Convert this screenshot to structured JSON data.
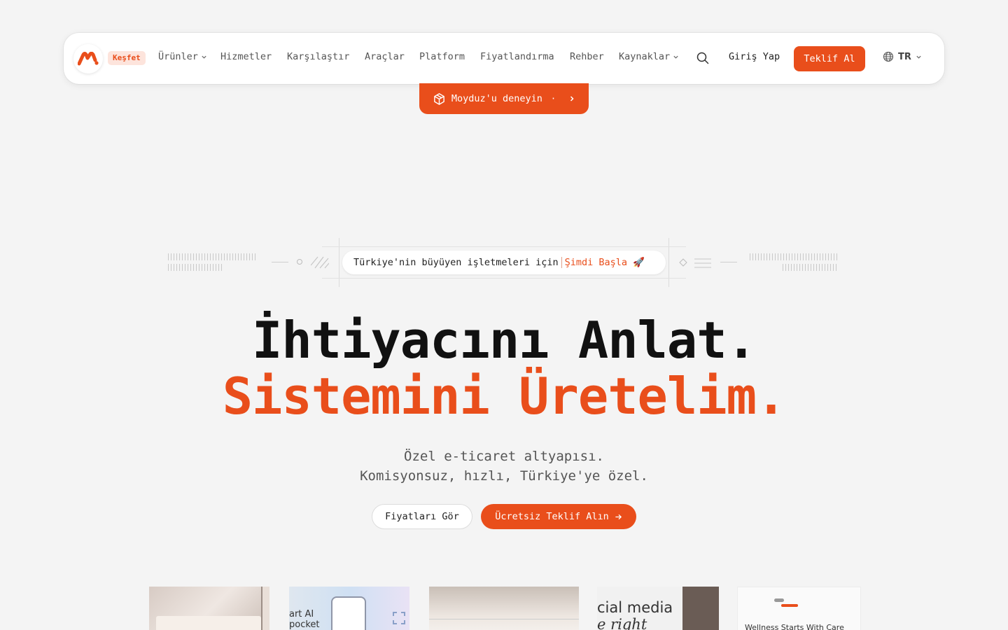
{
  "nav": {
    "badge": "Keşfet",
    "links": [
      {
        "label": "Ürünler",
        "dropdown": true
      },
      {
        "label": "Hizmetler"
      },
      {
        "label": "Karşılaştır"
      },
      {
        "label": "Araçlar"
      },
      {
        "label": "Platform"
      },
      {
        "label": "Fiyatlandırma"
      },
      {
        "label": "Rehber"
      },
      {
        "label": "Kaynaklar",
        "dropdown": true
      }
    ],
    "login": "Giriş Yap",
    "cta": "Teklif Al",
    "lang": "TR"
  },
  "try_tab": {
    "label": "Moyduz'u deneyin",
    "dot": "·"
  },
  "pill": {
    "text": "Türkiye'nin büyüyen işletmeleri için",
    "link": "Şimdi Başla",
    "emoji": "🚀"
  },
  "hero": {
    "line1": "İhtiyacını Anlat.",
    "line2": "Sistemini Üretelim.",
    "sub1": "Özel e-ticaret altyapısı.",
    "sub2": "Komisyonsuz, hızlı, Türkiye'ye özel."
  },
  "buttons": {
    "secondary": "Fiyatları Gör",
    "primary": "Ücretsiz Teklif Alın"
  },
  "previews": {
    "p2_text": "art AI pocket",
    "p4_text1": "cial media",
    "p4_text2": "e right",
    "p5_text": "Wellness Starts With Care"
  },
  "colors": {
    "accent": "#e94e1b",
    "background": "#f4f4f4"
  }
}
